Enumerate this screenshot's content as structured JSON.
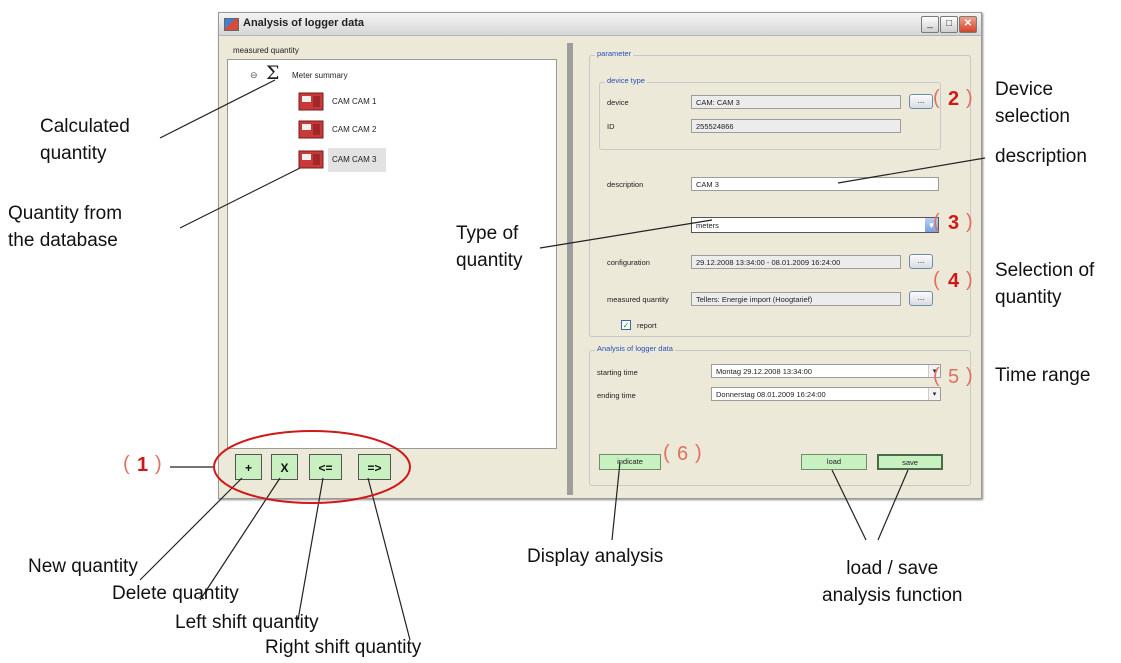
{
  "window": {
    "title": "Analysis of logger data",
    "buttons": {
      "minimize": "_",
      "maximize": "□",
      "close": "✕"
    }
  },
  "left_panel": {
    "label": "measured quantity",
    "tree": {
      "root": {
        "symbol": "Σ",
        "toggle": "⊖",
        "label": "Meter summary"
      },
      "children": [
        "CAM CAM 1",
        "CAM CAM 2",
        "CAM CAM 3"
      ]
    },
    "buttons": {
      "add": "+",
      "delete": "X",
      "left": "<=",
      "right": "=>"
    }
  },
  "parameter": {
    "group_title": "parameter",
    "device_type": {
      "group_title": "device type",
      "device_label": "device",
      "device_value": "CAM:  CAM 3",
      "id_label": "ID",
      "id_value": "255524866"
    },
    "description_label": "description",
    "description_value": "CAM 3",
    "type_value": "meters",
    "configuration_label": "configuration",
    "configuration_value": "29.12.2008 13:34:00 - 08.01.2009 16:24:00",
    "measured_label": "measured quantity",
    "measured_value": "Tellers: Energie import (Hoogtarief)",
    "report_label": "report",
    "report_checked": true,
    "dots": "..."
  },
  "analysis": {
    "group_title": "Analysis of logger data",
    "start_label": "starting time",
    "start_value": "Montag   29.12.2008    13:34:00",
    "end_label": "ending time",
    "end_value": "Donnerstag 08.01.2009    16:24:00",
    "indicate_button": "indicate",
    "load_button": "load",
    "save_button": "save"
  },
  "annotations": {
    "calculated_quantity": [
      "Calculated",
      "quantity"
    ],
    "quantity_from_db": [
      "Quantity from",
      "the database"
    ],
    "type_of_quantity": [
      "Type of",
      "quantity"
    ],
    "device_selection": [
      "Device",
      "selection"
    ],
    "description": "description",
    "selection_of_quantity": [
      "Selection of",
      "quantity"
    ],
    "time_range": "Time range",
    "new_quantity": "New quantity",
    "delete_quantity": "Delete quantity",
    "left_shift": "Left shift quantity",
    "right_shift": "Right shift quantity",
    "display_analysis": "Display analysis",
    "load_save": [
      "load / save",
      "analysis function"
    ],
    "markers": [
      "1",
      "2",
      "3",
      "4",
      "5",
      "6"
    ]
  },
  "colors": {
    "green_button": "#c8f0c0",
    "marker_red": "#d01818",
    "group_title_blue": "#2850b8",
    "window_bg": "#ece9d8"
  }
}
